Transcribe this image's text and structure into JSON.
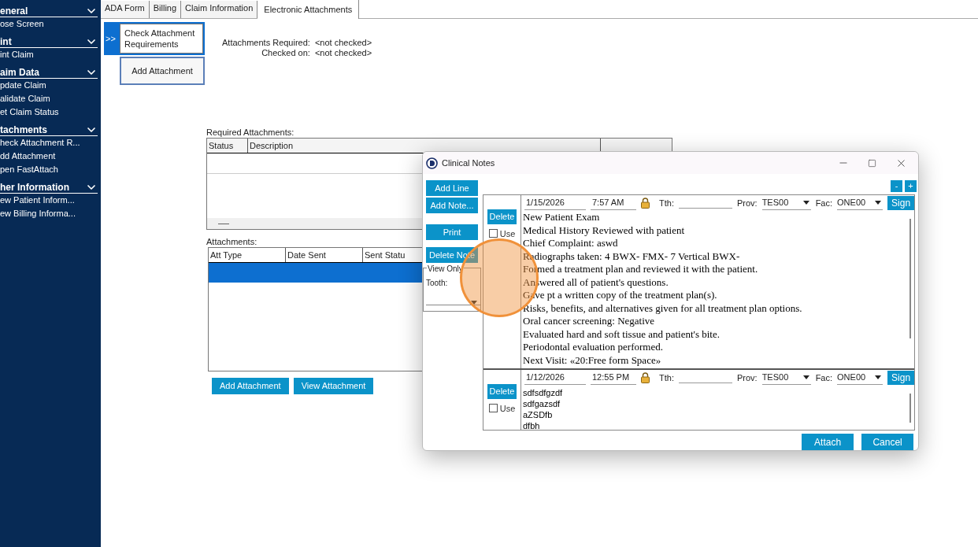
{
  "sidebar": {
    "sections": [
      {
        "title": "eneral",
        "items": [
          "ose Screen"
        ]
      },
      {
        "title": "int",
        "items": [
          "int Claim"
        ]
      },
      {
        "title": "aim Data",
        "items": [
          "pdate Claim",
          "alidate Claim",
          "et Claim Status"
        ]
      },
      {
        "title": "tachments",
        "items": [
          "heck Attachment R...",
          "dd Attachment",
          "pen FastAttach"
        ]
      },
      {
        "title": "her Information",
        "items": [
          "ew Patient Inform...",
          "ew Billing Informa..."
        ]
      }
    ]
  },
  "tabs": [
    {
      "label": "ADA Form",
      "selected": false
    },
    {
      "label": "Billing",
      "selected": false
    },
    {
      "label": "Claim Information",
      "selected": false
    },
    {
      "label": "Electronic Attachments",
      "selected": true
    }
  ],
  "actions": {
    "marker": ">>",
    "check_button": "Check Attachment Requirements",
    "add_button": "Add Attachment"
  },
  "status": [
    {
      "label": "Attachments Required:",
      "value": "<not checked>"
    },
    {
      "label": "Checked on:",
      "value": "<not checked>"
    }
  ],
  "required_attachments": {
    "label": "Required Attachments:",
    "columns": [
      "Status",
      "Description"
    ]
  },
  "attachments": {
    "label": "Attachments:",
    "columns": [
      "Att Type",
      "Date Sent",
      "Sent Statu"
    ],
    "rows": [
      {
        "selected": true
      }
    ]
  },
  "buttons": [
    "Add Attachment",
    "View Attachment"
  ],
  "dialog": {
    "title": "Clinical Notes",
    "side_buttons": [
      [
        "Add Line",
        "Add Note..."
      ],
      [
        "Print"
      ],
      [
        "Delete Note"
      ]
    ],
    "view_only": {
      "legend": "View Only",
      "tooth_label": "Tooth:"
    },
    "zoom_buttons": [
      "-",
      "+"
    ],
    "notes": [
      {
        "kind": "serif",
        "delete": "Delete",
        "use_label": "Use",
        "use": false,
        "date": "1/15/2026",
        "time": "7:57 AM",
        "tth_label": "Tth:",
        "prov_label": "Prov:",
        "prov": "TES00",
        "fac_label": "Fac:",
        "fac": "ONE00",
        "sign": "Sign",
        "lines": [
          "New Patient Exam",
          "Medical History Reviewed with patient",
          "Chief Complaint: aswd",
          "Radiographs taken: 4 BWX- FMX- 7 Vertical BWX-",
          "Formed a treatment plan and reviewed it with the patient.",
          "Answered all of patient's questions.",
          "Gave pt a written copy of the treatment plan(s).",
          "Risks, benefits, and alternatives given for all treatment plan options.",
          "Oral cancer screening: Negative",
          "Evaluated hard and soft tissue and patient's bite.",
          "Periodontal evaluation performed.",
          "Next Visit: «20:Free form Space»"
        ]
      },
      {
        "kind": "sans",
        "delete": "Delete",
        "use_label": "Use",
        "use": false,
        "date": "1/12/2026",
        "time": "12:55 PM",
        "tth_label": "Tth:",
        "prov_label": "Prov:",
        "prov": "TES00",
        "fac_label": "Fac:",
        "fac": "ONE00",
        "sign": "Sign",
        "lines": [
          "sdfsdfgzdf",
          "sdfgazsdf",
          "aZSDfb",
          "dfbh"
        ]
      }
    ],
    "footer_buttons": [
      "Attach",
      "Cancel"
    ]
  }
}
